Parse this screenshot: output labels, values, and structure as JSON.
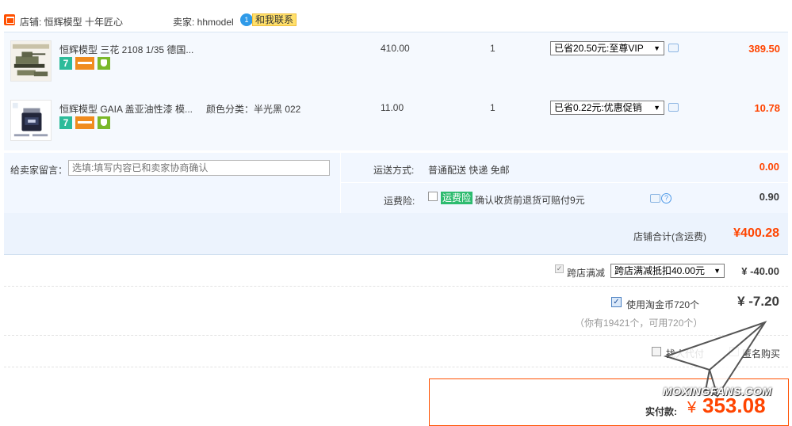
{
  "shop": {
    "label": "店铺: 恒辉模型 十年匠心",
    "seller_label": "卖家: hhmodel",
    "ww_badge": "1",
    "contact_label": "和我联系"
  },
  "items": [
    {
      "title": "恒辉模型 三花 2108 1/35 德国...",
      "sku": "",
      "price": "410.00",
      "qty": "1",
      "promo": "已省20.50元:至尊VIP",
      "subtotal": "389.50",
      "badge_text": "7"
    },
    {
      "title": "恒辉模型 GAIA 盖亚油性漆 模...",
      "sku": "颜色分类：半光黑 022",
      "price": "11.00",
      "qty": "1",
      "promo": "已省0.22元:优惠促销",
      "subtotal": "10.78",
      "badge_text": "7"
    }
  ],
  "message": {
    "label": "给卖家留言：",
    "placeholder": "选填:填写内容已和卖家协商确认"
  },
  "shipping": {
    "label": "运送方式:",
    "value": "普通配送 快递 免邮",
    "fee": "0.00"
  },
  "insurance": {
    "label": "运费险:",
    "tag": "运费险",
    "desc": "确认收货前退货可赔付9元",
    "fee": "0.90",
    "help": "?"
  },
  "shop_total": {
    "label": "店铺合计(含运费)",
    "value": "¥400.28"
  },
  "cross_discount": {
    "label": "跨店满减",
    "select": "跨店满减抵扣40.00元",
    "amount": "¥ -40.00"
  },
  "coins": {
    "label": "使用淘金币720个",
    "amount": "¥ -7.20",
    "note": "（你有19421个，可用720个）"
  },
  "options": {
    "proxy_pay": "找人代付",
    "anonymous": "匿名购买"
  },
  "pay": {
    "label": "实付款:",
    "currency": "¥",
    "value": "353.08"
  },
  "watermark": "MOXINGFANS.COM",
  "colors": {
    "accent": "#ff4400",
    "pay_border": "#ff5000",
    "row_bg": "#f5f9fe",
    "total_bg": "#ecf3fd",
    "green_badge": "#2dbb9a"
  },
  "icons": {
    "shop": "shop-icon",
    "wangwang": "wangwang-icon",
    "chat": "chat-bubble-icon",
    "help": "question-circle-icon",
    "badge_card": "credit-card-badge-icon",
    "badge_safe": "security-badge-icon"
  }
}
